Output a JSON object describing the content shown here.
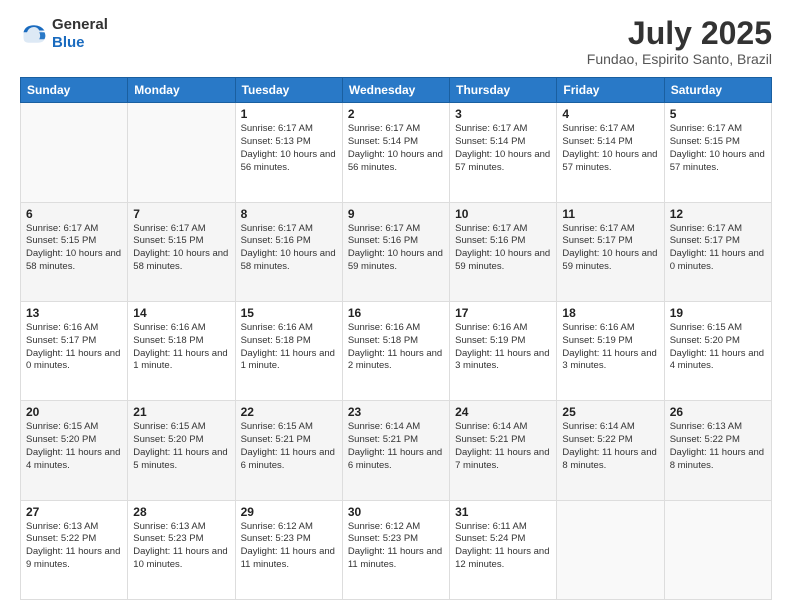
{
  "logo": {
    "general": "General",
    "blue": "Blue"
  },
  "header": {
    "title": "July 2025",
    "subtitle": "Fundao, Espirito Santo, Brazil"
  },
  "weekdays": [
    "Sunday",
    "Monday",
    "Tuesday",
    "Wednesday",
    "Thursday",
    "Friday",
    "Saturday"
  ],
  "weeks": [
    [
      {
        "day": "",
        "info": ""
      },
      {
        "day": "",
        "info": ""
      },
      {
        "day": "1",
        "info": "Sunrise: 6:17 AM\nSunset: 5:13 PM\nDaylight: 10 hours and 56 minutes."
      },
      {
        "day": "2",
        "info": "Sunrise: 6:17 AM\nSunset: 5:14 PM\nDaylight: 10 hours and 56 minutes."
      },
      {
        "day": "3",
        "info": "Sunrise: 6:17 AM\nSunset: 5:14 PM\nDaylight: 10 hours and 57 minutes."
      },
      {
        "day": "4",
        "info": "Sunrise: 6:17 AM\nSunset: 5:14 PM\nDaylight: 10 hours and 57 minutes."
      },
      {
        "day": "5",
        "info": "Sunrise: 6:17 AM\nSunset: 5:15 PM\nDaylight: 10 hours and 57 minutes."
      }
    ],
    [
      {
        "day": "6",
        "info": "Sunrise: 6:17 AM\nSunset: 5:15 PM\nDaylight: 10 hours and 58 minutes."
      },
      {
        "day": "7",
        "info": "Sunrise: 6:17 AM\nSunset: 5:15 PM\nDaylight: 10 hours and 58 minutes."
      },
      {
        "day": "8",
        "info": "Sunrise: 6:17 AM\nSunset: 5:16 PM\nDaylight: 10 hours and 58 minutes."
      },
      {
        "day": "9",
        "info": "Sunrise: 6:17 AM\nSunset: 5:16 PM\nDaylight: 10 hours and 59 minutes."
      },
      {
        "day": "10",
        "info": "Sunrise: 6:17 AM\nSunset: 5:16 PM\nDaylight: 10 hours and 59 minutes."
      },
      {
        "day": "11",
        "info": "Sunrise: 6:17 AM\nSunset: 5:17 PM\nDaylight: 10 hours and 59 minutes."
      },
      {
        "day": "12",
        "info": "Sunrise: 6:17 AM\nSunset: 5:17 PM\nDaylight: 11 hours and 0 minutes."
      }
    ],
    [
      {
        "day": "13",
        "info": "Sunrise: 6:16 AM\nSunset: 5:17 PM\nDaylight: 11 hours and 0 minutes."
      },
      {
        "day": "14",
        "info": "Sunrise: 6:16 AM\nSunset: 5:18 PM\nDaylight: 11 hours and 1 minute."
      },
      {
        "day": "15",
        "info": "Sunrise: 6:16 AM\nSunset: 5:18 PM\nDaylight: 11 hours and 1 minute."
      },
      {
        "day": "16",
        "info": "Sunrise: 6:16 AM\nSunset: 5:18 PM\nDaylight: 11 hours and 2 minutes."
      },
      {
        "day": "17",
        "info": "Sunrise: 6:16 AM\nSunset: 5:19 PM\nDaylight: 11 hours and 3 minutes."
      },
      {
        "day": "18",
        "info": "Sunrise: 6:16 AM\nSunset: 5:19 PM\nDaylight: 11 hours and 3 minutes."
      },
      {
        "day": "19",
        "info": "Sunrise: 6:15 AM\nSunset: 5:20 PM\nDaylight: 11 hours and 4 minutes."
      }
    ],
    [
      {
        "day": "20",
        "info": "Sunrise: 6:15 AM\nSunset: 5:20 PM\nDaylight: 11 hours and 4 minutes."
      },
      {
        "day": "21",
        "info": "Sunrise: 6:15 AM\nSunset: 5:20 PM\nDaylight: 11 hours and 5 minutes."
      },
      {
        "day": "22",
        "info": "Sunrise: 6:15 AM\nSunset: 5:21 PM\nDaylight: 11 hours and 6 minutes."
      },
      {
        "day": "23",
        "info": "Sunrise: 6:14 AM\nSunset: 5:21 PM\nDaylight: 11 hours and 6 minutes."
      },
      {
        "day": "24",
        "info": "Sunrise: 6:14 AM\nSunset: 5:21 PM\nDaylight: 11 hours and 7 minutes."
      },
      {
        "day": "25",
        "info": "Sunrise: 6:14 AM\nSunset: 5:22 PM\nDaylight: 11 hours and 8 minutes."
      },
      {
        "day": "26",
        "info": "Sunrise: 6:13 AM\nSunset: 5:22 PM\nDaylight: 11 hours and 8 minutes."
      }
    ],
    [
      {
        "day": "27",
        "info": "Sunrise: 6:13 AM\nSunset: 5:22 PM\nDaylight: 11 hours and 9 minutes."
      },
      {
        "day": "28",
        "info": "Sunrise: 6:13 AM\nSunset: 5:23 PM\nDaylight: 11 hours and 10 minutes."
      },
      {
        "day": "29",
        "info": "Sunrise: 6:12 AM\nSunset: 5:23 PM\nDaylight: 11 hours and 11 minutes."
      },
      {
        "day": "30",
        "info": "Sunrise: 6:12 AM\nSunset: 5:23 PM\nDaylight: 11 hours and 11 minutes."
      },
      {
        "day": "31",
        "info": "Sunrise: 6:11 AM\nSunset: 5:24 PM\nDaylight: 11 hours and 12 minutes."
      },
      {
        "day": "",
        "info": ""
      },
      {
        "day": "",
        "info": ""
      }
    ]
  ]
}
